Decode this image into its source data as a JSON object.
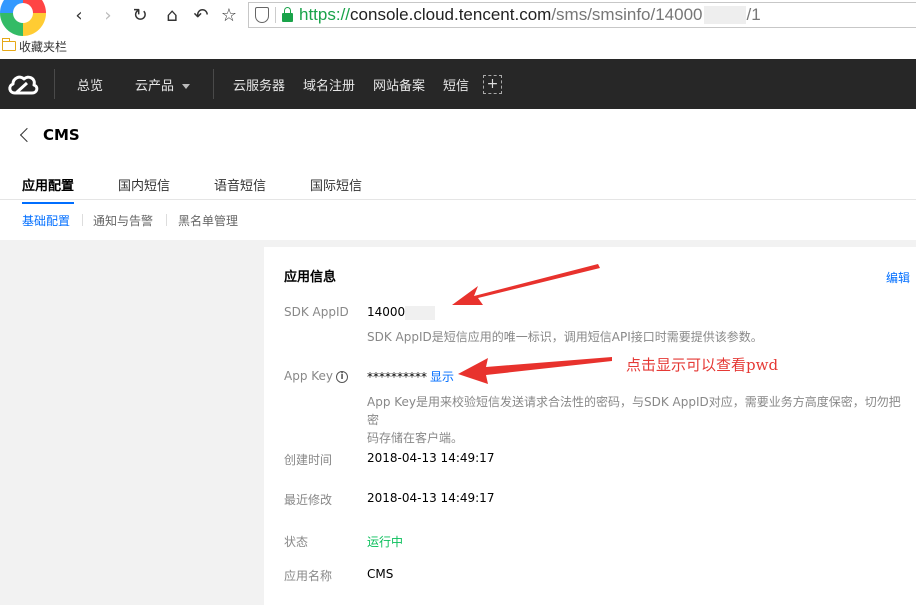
{
  "browser": {
    "url_https": "https://",
    "url_host": "console.cloud.tencent.com",
    "url_path_a": "/sms/smsinfo/14000",
    "url_path_b": "/1",
    "bookmarks_label": "收藏夹栏"
  },
  "topnav": {
    "overview": "总览",
    "products": "云产品",
    "cvm": "云服务器",
    "domain": "域名注册",
    "icp": "网站备案",
    "sms": "短信",
    "plus": "+"
  },
  "page": {
    "title": "CMS",
    "tabs": [
      "应用配置",
      "国内短信",
      "语音短信",
      "国际短信"
    ],
    "subtabs": [
      "基础配置",
      "通知与告警",
      "黑名单管理"
    ]
  },
  "card": {
    "title": "应用信息",
    "edit": "编辑",
    "sdk_label": "SDK AppID",
    "sdk_value": "14000",
    "sdk_desc": "SDK AppID是短信应用的唯一标识，调用短信API接口时需要提供该参数。",
    "key_label": "App Key",
    "key_value": "**********",
    "key_show": "显示",
    "key_desc_1": "App Key是用来校验短信发送请求合法性的密码，与SDK AppID对应，需要业务方高度保密，切勿把密",
    "key_desc_2": "码存储在客户端。",
    "created_label": "创建时间",
    "created_value": "2018-04-13 14:49:17",
    "modified_label": "最近修改",
    "modified_value": "2018-04-13 14:49:17",
    "status_label": "状态",
    "status_value": "运行中",
    "appname_label": "应用名称",
    "appname_value": "CMS"
  },
  "annotation": {
    "text": "点击显示可以查看pwd"
  },
  "colors": {
    "accent": "#006eff",
    "status_ok": "#0abf5b",
    "annotation": "#e53935",
    "nav_bg": "#272727"
  }
}
